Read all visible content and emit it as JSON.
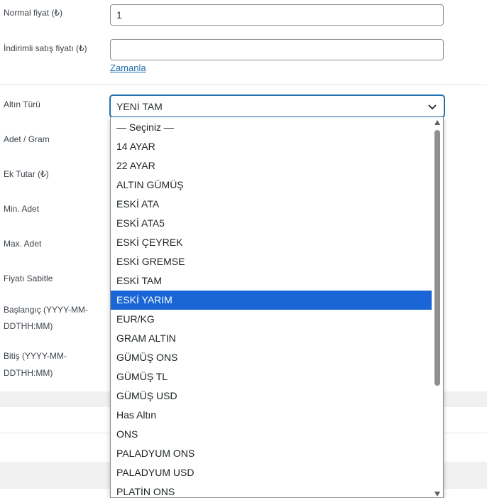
{
  "fields": {
    "regular_price": {
      "label": "Normal fiyat (₺)",
      "value": "1"
    },
    "sale_price": {
      "label": "İndirimli satış fiyatı (₺)",
      "value": "",
      "schedule_link": "Zamanla"
    },
    "gold_type": {
      "label": "Altın Türü",
      "selected": "YENİ TAM"
    },
    "unit_gram": {
      "label": "Adet / Gram"
    },
    "extra_amount": {
      "label": "Ek Tutar (₺)"
    },
    "min_qty": {
      "label": "Min. Adet"
    },
    "max_qty": {
      "label": "Max. Adet"
    },
    "fixed_price": {
      "label": "Fiyatı Sabitle"
    },
    "start": {
      "label_line1": "Başlangıç (YYYY-MM-",
      "label_line2": "DDTHH:MM)"
    },
    "end": {
      "label_line1": "Bitiş (YYYY-MM-",
      "label_line2": "DDTHH:MM)"
    }
  },
  "dropdown": {
    "highlighted": "ESKİ YARIM",
    "options": [
      "— Seçiniz —",
      "14 AYAR",
      "22 AYAR",
      "ALTIN GÜMÜŞ",
      "ESKİ ATA",
      "ESKİ ATA5",
      "ESKİ ÇEYREK",
      "ESKİ GREMSE",
      "ESKİ TAM",
      "ESKİ YARIM",
      "EUR/KG",
      "GRAM ALTIN",
      "GÜMÜŞ ONS",
      "GÜMÜŞ TL",
      "GÜMÜŞ USD",
      "Has Altın",
      "ONS",
      "PALADYUM ONS",
      "PALADYUM USD",
      "PLATİN ONS"
    ]
  },
  "colors": {
    "accent": "#2271b1",
    "highlight": "#1a66d6"
  },
  "icons": {
    "select_arrow": "chevron-down-icon"
  }
}
